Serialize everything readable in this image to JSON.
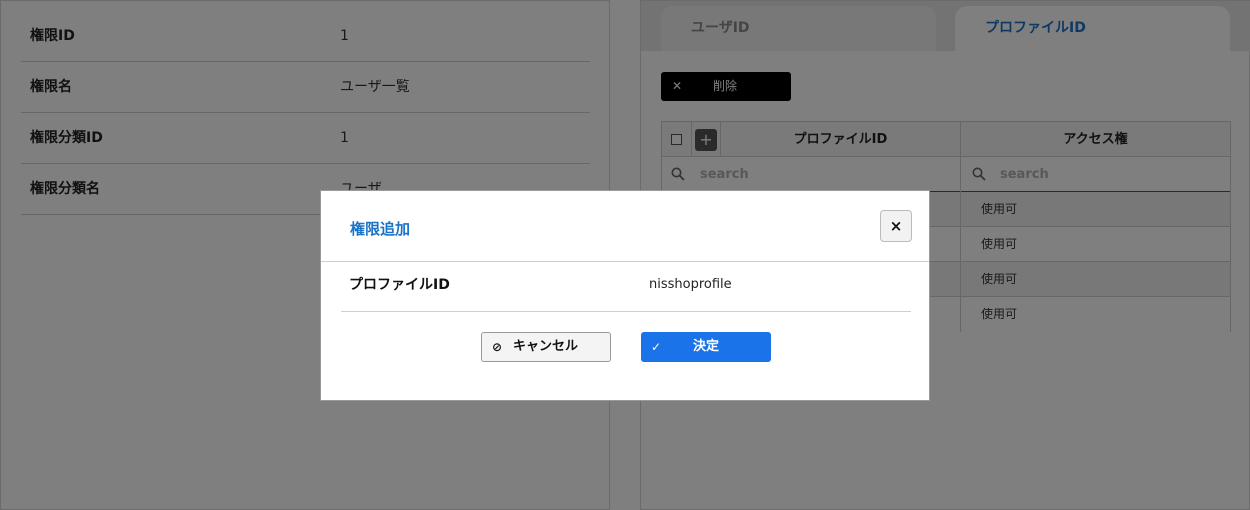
{
  "left_panel": {
    "rows": [
      {
        "label": "権限ID",
        "value": "1"
      },
      {
        "label": "権限名",
        "value": "ユーザ一覧"
      },
      {
        "label": "権限分類ID",
        "value": "1"
      },
      {
        "label": "権限分類名",
        "value": "ユーザ"
      }
    ]
  },
  "right_panel": {
    "tabs": [
      {
        "label": "ユーザID",
        "active": false
      },
      {
        "label": "プロファイルID",
        "active": true
      }
    ],
    "delete_button": {
      "icon": "close-icon",
      "label": "削除"
    },
    "grid": {
      "add_icon": "+",
      "columns": [
        "プロファイルID",
        "アクセス権"
      ],
      "search_placeholders": [
        "search",
        "search"
      ],
      "rows": [
        {
          "access": "使用可"
        },
        {
          "access": "使用可"
        },
        {
          "access": "使用可"
        },
        {
          "access": "使用可"
        }
      ]
    }
  },
  "modal": {
    "title": "権限追加",
    "close_label": "×",
    "field": {
      "label": "プロファイルID",
      "value": "nisshoprofile"
    },
    "cancel_button": {
      "icon": "⊘",
      "label": "キャンセル"
    },
    "ok_button": {
      "icon": "✓",
      "label": "決定"
    },
    "colors": {
      "accent": "#1a73c8",
      "primary_button": "#1a73e8"
    }
  }
}
